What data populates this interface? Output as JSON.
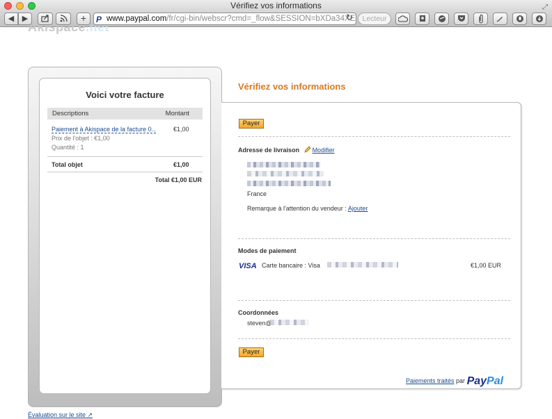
{
  "window": {
    "title": "Vérifiez vos informations"
  },
  "browser": {
    "url_host": "www.paypal.com",
    "url_path": "/fr/cgi-bin/webscr?cmd=_flow&SESSION=bXDa34XE8TxY(",
    "reader_label": "Lecteur"
  },
  "invoice": {
    "title": "Voici votre facture",
    "col_desc": "Descriptions",
    "col_amount": "Montant",
    "item_name": "Paiement à Akispace de la facture 0...",
    "item_amount": "€1,00",
    "item_price": "Prix de l'objet : €1,00",
    "item_qty": "Quantité : 1",
    "total_label": "Total objet",
    "total_amount": "€1,00",
    "grand_total": "Total €1,00 EUR"
  },
  "main": {
    "title": "Vérifiez vos informations",
    "pay_label": "Payer",
    "shipping_title": "Adresse de livraison",
    "modify_label": "Modifier",
    "country": "France",
    "remark_label": "Remarque à l'attention du vendeur :",
    "add_label": "Ajouter",
    "payment_title": "Modes de paiement",
    "visa_label": "VISA",
    "card_label": "Carte bancaire : Visa",
    "payment_amount": "€1,00 EUR",
    "contact_title": "Coordonnées",
    "contact_email": "steven@"
  },
  "footer": {
    "processed_label": "Paiements traités",
    "by_label": "par",
    "paypal_pay": "Pay",
    "paypal_pal": "Pal",
    "site_eval": "Évaluation sur le site"
  },
  "colors": {
    "accent": "#d87a1e",
    "link": "#1b4a90",
    "paypal_dark": "#1a2f8a",
    "paypal_light": "#2a8fd8"
  }
}
